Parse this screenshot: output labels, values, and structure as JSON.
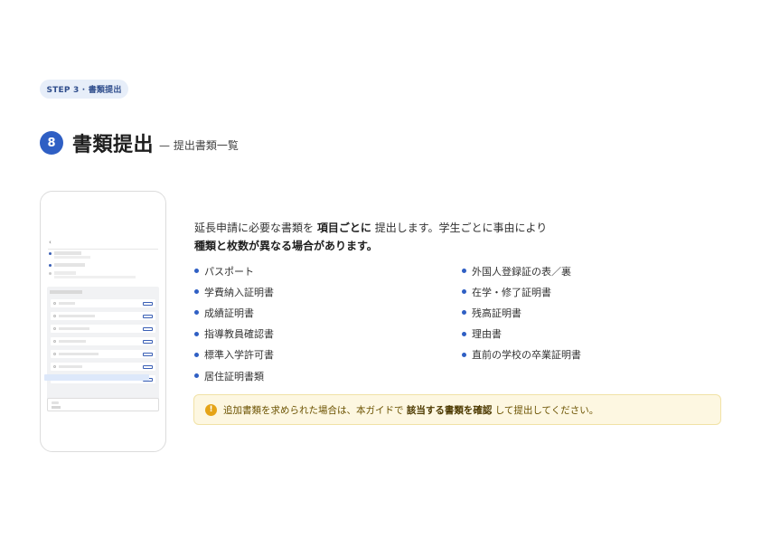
{
  "step_label": "STEP 3 · 書類提出",
  "section": {
    "number": "8",
    "title": "書類提出",
    "subtitle": "— 提出書類一覧"
  },
  "intro": {
    "line1_pre": "延長申請に必要な書類を",
    "line1_bold": "項目ごとに",
    "line1_post": "提出します。学生ごとに事由により",
    "line2_bold": "種類と枚数が異なる場合があります。"
  },
  "documents_left": [
    "パスポート",
    "学費納入証明書",
    "成績証明書",
    "指導教員確認書",
    "標準入学許可書",
    "居住証明書類"
  ],
  "documents_right": [
    "外国人登録証の表／裏",
    "在学・修了証明書",
    "残高証明書",
    "理由書",
    "直前の学校の卒業証明書"
  ],
  "note": {
    "icon": "warning-icon",
    "pre": "追加書類を求められた場合は、本ガイドで",
    "bold": "該当する書類を確認",
    "post": "して提出してください。"
  },
  "colors": {
    "accent": "#2f5fc4",
    "pill_bg": "#e7eef9",
    "note_bg": "#fdf7e1",
    "note_border": "#f1e2a6",
    "warning": "#e5a418"
  }
}
